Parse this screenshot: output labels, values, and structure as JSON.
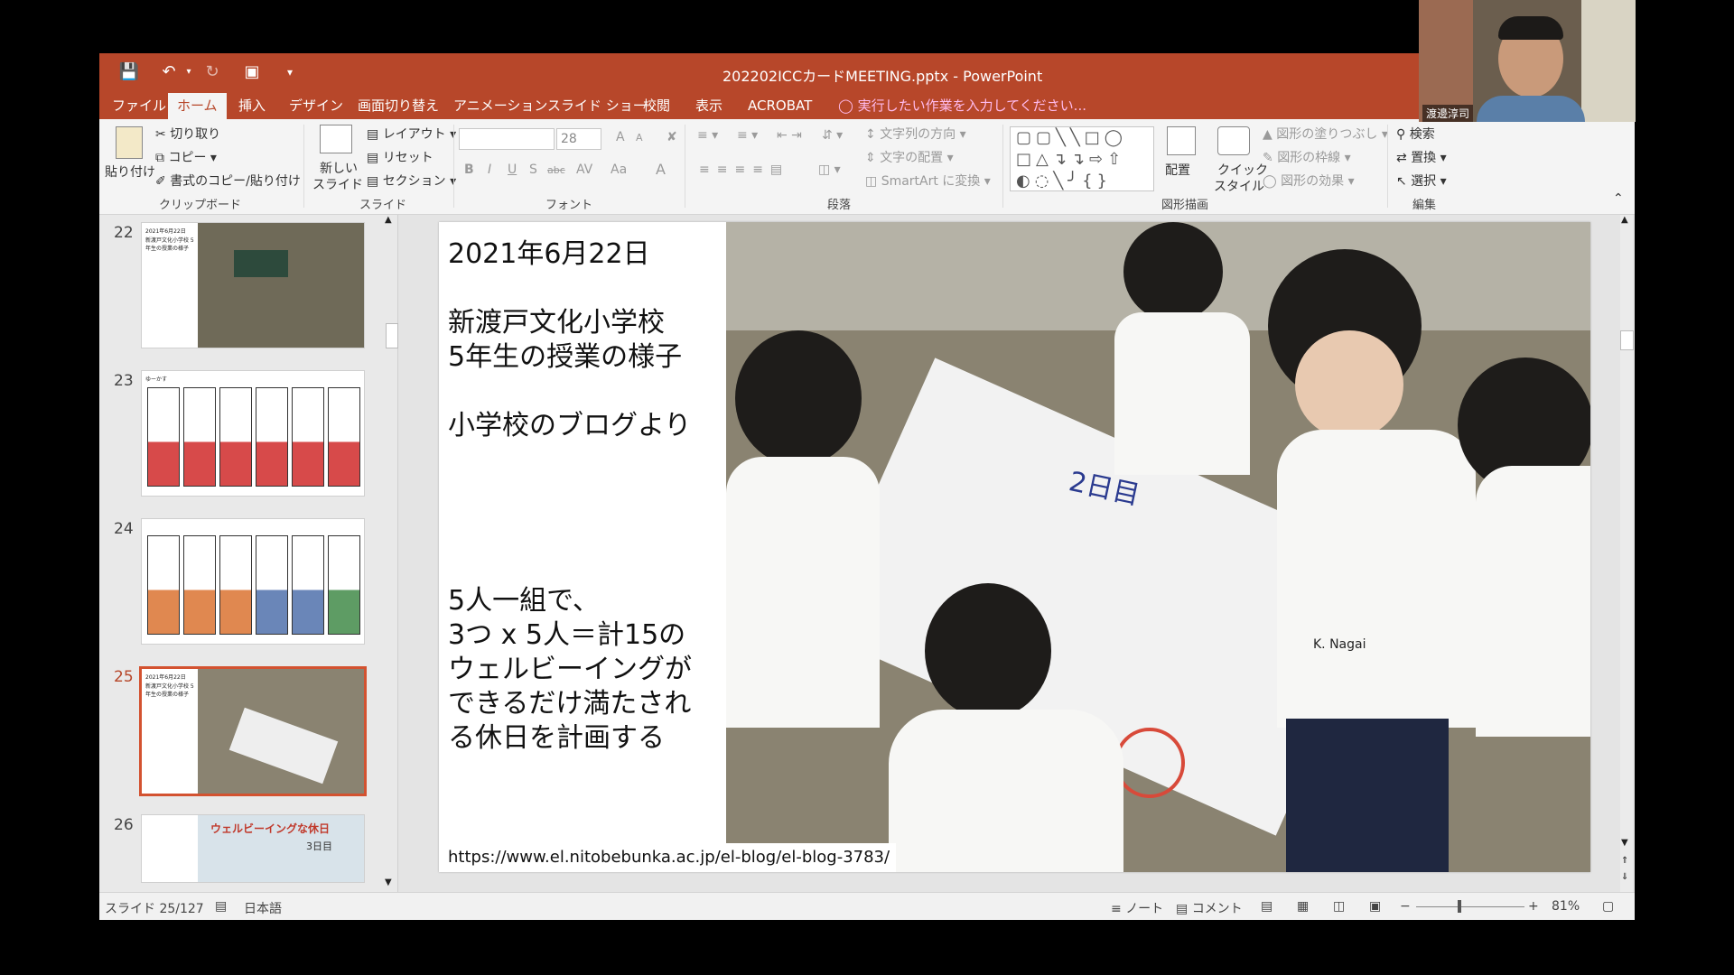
{
  "window": {
    "title": "202202ICCカードMEETING.pptx - PowerPoint"
  },
  "quick_access": {
    "save_icon": "save-icon",
    "undo_icon": "undo-icon",
    "redo_icon": "redo-icon",
    "present_icon": "present-icon",
    "customize_icon": "customize-icon"
  },
  "tabs": [
    "ファイル",
    "ホーム",
    "挿入",
    "デザイン",
    "画面切り替え",
    "アニメーション",
    "スライド ショー",
    "校閲",
    "表示",
    "ACROBAT"
  ],
  "active_tab": "ホーム",
  "tell_me": "実行したい作業を入力してください...",
  "ribbon": {
    "clipboard": {
      "paste": "貼り付け",
      "cut": "切り取り",
      "copy": "コピー",
      "format_painter": "書式のコピー/貼り付け",
      "label": "クリップボード"
    },
    "slides": {
      "new_slide_1": "新しい",
      "new_slide_2": "スライド",
      "layout": "レイアウト",
      "reset": "リセット",
      "section": "セクション",
      "label": "スライド"
    },
    "font": {
      "size": "28",
      "bold": "B",
      "italic": "I",
      "underline": "U",
      "shadow": "S",
      "strike": "abc",
      "spacing": "AV",
      "case": "Aa",
      "color": "A",
      "grow": "A",
      "shrink": "A",
      "label": "フォント"
    },
    "paragraph": {
      "text_direction": "文字列の方向",
      "align_text": "文字の配置",
      "smartart": "SmartArt に変換",
      "label": "段落"
    },
    "drawing": {
      "arrange": "配置",
      "quick_styles_1": "クイック",
      "quick_styles_2": "スタイル",
      "shape_fill": "図形の塗りつぶし",
      "shape_outline": "図形の枠線",
      "shape_effects": "図形の効果",
      "label": "図形描画"
    },
    "editing": {
      "find": "検索",
      "replace": "置換",
      "select": "選択",
      "label": "編集"
    }
  },
  "thumbnails": [
    {
      "num": "22",
      "title": "2021年6月22日",
      "caption": "新渡戸文化小学校 5年生の授業の様子"
    },
    {
      "num": "23",
      "title": "ゆーかす",
      "caption": ""
    },
    {
      "num": "24",
      "title": "",
      "caption": ""
    },
    {
      "num": "25",
      "title": "2021年6月22日",
      "caption": "新渡戸文化小学校 5年生の授業の様子"
    },
    {
      "num": "26",
      "title": "ウェルビーイングな休日",
      "caption": "3日目"
    }
  ],
  "active_slide_num": "25",
  "slide": {
    "date": "2021年6月22日",
    "school_line1": "新渡戸文化小学校",
    "school_line2": "5年生の授業の様子",
    "source": "小学校のブログより",
    "task_line1": "5人一組で、",
    "task_line2": "3つ x 5人＝計15の",
    "task_line3": "ウェルビーイングが",
    "task_line4": "できるだけ満たされ",
    "task_line5": "る休日を計画する",
    "url": "https://www.el.nitobebunka.ac.jp/el-blog/el-blog-3783/",
    "photo_board_text": "2日目",
    "photo_shirt_text": "K. Nagai"
  },
  "status": {
    "slide_count": "スライド 25/127",
    "language": "日本語",
    "notes": "ノート",
    "comments": "コメント",
    "zoom": "81%"
  },
  "webcam": {
    "name": "渡邊淳司"
  },
  "colors": {
    "accent": "#b7472a",
    "ribbon": "#f4f4f4",
    "active_thumb_border": "#d35230"
  }
}
